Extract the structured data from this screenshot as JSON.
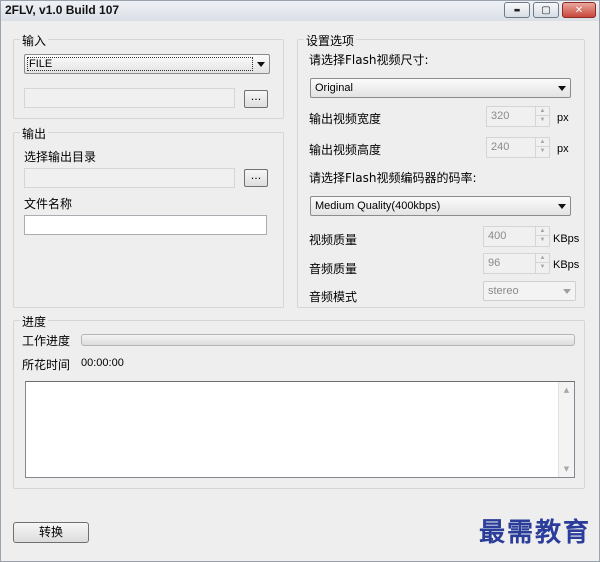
{
  "window": {
    "title": "2FLV, v1.0 Build 107",
    "minimize_glyph": "▬",
    "maximize_glyph": "▢",
    "close_glyph": "✕"
  },
  "input_group": {
    "title": "输入",
    "source_type": "FILE",
    "file_path": "",
    "browse_label": "..."
  },
  "output_group": {
    "title": "输出",
    "dir_label": "选择输出目录",
    "dir_value": "",
    "browse_label": "...",
    "filename_label": "文件名称",
    "filename_value": ""
  },
  "settings": {
    "title": "设置选项",
    "size_prompt": "请选择Flash视频尺寸:",
    "size_value": "Original",
    "width_label": "输出视频宽度",
    "width_value": "320",
    "width_unit": "px",
    "height_label": "输出视频高度",
    "height_value": "240",
    "height_unit": "px",
    "bitrate_prompt": "请选择Flash视频编码器的码率:",
    "bitrate_value": "Medium Quality(400kbps)",
    "video_quality_label": "视频质量",
    "video_quality_value": "400",
    "video_quality_unit": "KBps",
    "audio_quality_label": "音频质量",
    "audio_quality_value": "96",
    "audio_quality_unit": "KBps",
    "audio_mode_label": "音频模式",
    "audio_mode_value": "stereo"
  },
  "progress": {
    "title": "进度",
    "work_label": "工作进度",
    "percent": 0,
    "time_label": "所花时间",
    "time_value": "00:00:00",
    "log": ""
  },
  "footer": {
    "convert_label": "转换",
    "watermark": "最需教育"
  },
  "colors": {
    "window_bg": "#eeeeee",
    "watermark": "#2b3d9a"
  }
}
